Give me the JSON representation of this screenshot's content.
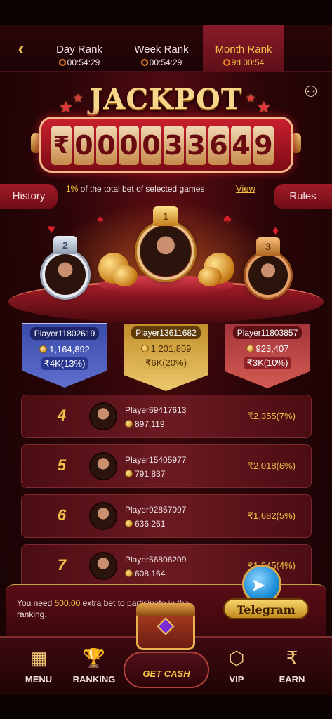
{
  "tabs": [
    {
      "label": "Day Rank",
      "timer": "00:54:29",
      "active": false
    },
    {
      "label": "Week Rank",
      "timer": "00:54:29",
      "active": false
    },
    {
      "label": "Month Rank",
      "timer": "9d 00:54",
      "active": true
    }
  ],
  "jackpot": {
    "title": "JACKPOT",
    "currency": "₹",
    "digits": [
      "0",
      "0",
      "0",
      "0",
      "3",
      "3",
      "6",
      "4",
      "9"
    ]
  },
  "history_label": "History",
  "rules_label": "Rules",
  "info": {
    "percent": "1%",
    "text": " of the total bet of selected games",
    "view": "View"
  },
  "podium": [
    {
      "rank": "2",
      "name": "Player11802619",
      "score": "1,164,892",
      "reward": "₹4K(13%)"
    },
    {
      "rank": "1",
      "name": "Player13611682",
      "score": "1,201,859",
      "reward": "₹6K(20%)"
    },
    {
      "rank": "3",
      "name": "Player11803857",
      "score": "923,407",
      "reward": "₹3K(10%)"
    }
  ],
  "ranks": [
    {
      "rank": "4",
      "name": "Player69417613",
      "score": "897,119",
      "reward": "₹2,355(7%)"
    },
    {
      "rank": "5",
      "name": "Player15405977",
      "score": "791,837",
      "reward": "₹2,018(6%)"
    },
    {
      "rank": "6",
      "name": "Player92857097",
      "score": "636,261",
      "reward": "₹1,682(5%)"
    },
    {
      "rank": "7",
      "name": "Player56806209",
      "score": "608,164",
      "reward": "₹1,345(4%)"
    }
  ],
  "notice": {
    "prefix": "You need ",
    "amount": "500.00",
    "suffix": " extra bet to participate in the ranking."
  },
  "telegram_label": "Telegram",
  "nav": [
    {
      "label": "MENU",
      "icon": "menu-grid-icon"
    },
    {
      "label": "RANKING",
      "icon": "trophy-icon"
    },
    {
      "label": "GET CASH",
      "icon": "treasure-chest-icon"
    },
    {
      "label": "VIP",
      "icon": "vip-badge-icon"
    },
    {
      "label": "EARN",
      "icon": "rupee-coin-icon"
    }
  ]
}
